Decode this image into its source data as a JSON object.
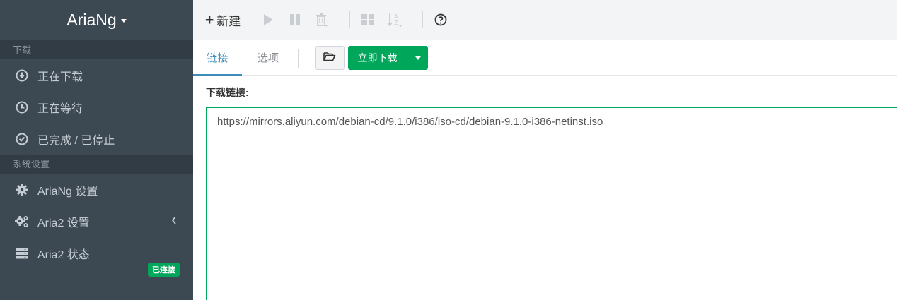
{
  "sidebar": {
    "brand": "AriaNg",
    "sections": [
      {
        "header": "下载",
        "items": [
          {
            "label": "正在下载",
            "icon": "download-circle-icon"
          },
          {
            "label": "正在等待",
            "icon": "clock-icon"
          },
          {
            "label": "已完成 / 已停止",
            "icon": "check-circle-icon"
          }
        ]
      },
      {
        "header": "系统设置",
        "items": [
          {
            "label": "AriaNg 设置",
            "icon": "gear-icon"
          },
          {
            "label": "Aria2 设置",
            "icon": "gears-icon"
          },
          {
            "label": "Aria2 状态",
            "icon": "server-icon"
          }
        ]
      }
    ],
    "status_badge": "已连接"
  },
  "toolbar": {
    "new_label": "新建",
    "icons": [
      "play-icon",
      "pause-icon",
      "trash-icon",
      "grid-icon",
      "sort-alpha-icon",
      "help-icon"
    ]
  },
  "tabs": [
    {
      "label": "链接",
      "active": true
    },
    {
      "label": "选项",
      "active": false
    }
  ],
  "actions": {
    "download_now_label": "立即下载"
  },
  "form": {
    "links_label": "下载链接:",
    "links_value": "https://mirrors.aliyun.com/debian-cd/9.1.0/i386/iso-cd/debian-9.1.0-i386-netinst.iso"
  },
  "colors": {
    "sidebar_bg": "#3c4852",
    "accent_blue": "#3c8dbc",
    "success_green": "#00a65a"
  }
}
